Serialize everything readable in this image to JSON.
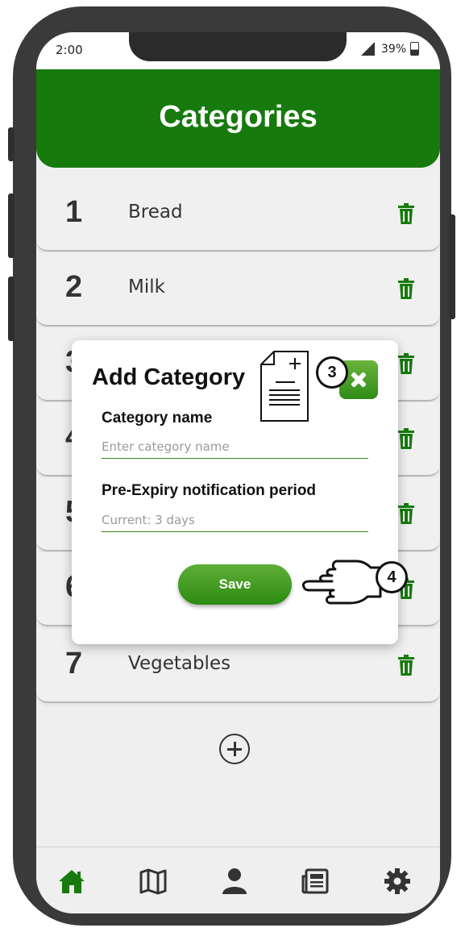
{
  "status_bar": {
    "time": "2:00",
    "battery": "39%"
  },
  "header": {
    "title": "Categories"
  },
  "categories": [
    {
      "number": "1",
      "name": "Bread"
    },
    {
      "number": "2",
      "name": "Milk"
    },
    {
      "number": "3",
      "name": ""
    },
    {
      "number": "4",
      "name": ""
    },
    {
      "number": "5",
      "name": ""
    },
    {
      "number": "6",
      "name": ""
    },
    {
      "number": "7",
      "name": "Vegetables"
    }
  ],
  "dialog": {
    "title": "Add Category",
    "category_name_label": "Category name",
    "category_name_placeholder": "Enter category name",
    "expiry_label": "Pre-Expiry notification period",
    "expiry_placeholder": "Current: 3 days",
    "save_label": "Save"
  },
  "annotations": {
    "callout_new_doc": "3",
    "callout_pointer": "4"
  },
  "nav": {
    "items": [
      "home-icon",
      "map-icon",
      "user-icon",
      "news-icon",
      "gear-icon"
    ],
    "active_color": "#177a0d"
  },
  "colors": {
    "brand_green": "#177a0d",
    "accent_green": "#2f8c17"
  }
}
